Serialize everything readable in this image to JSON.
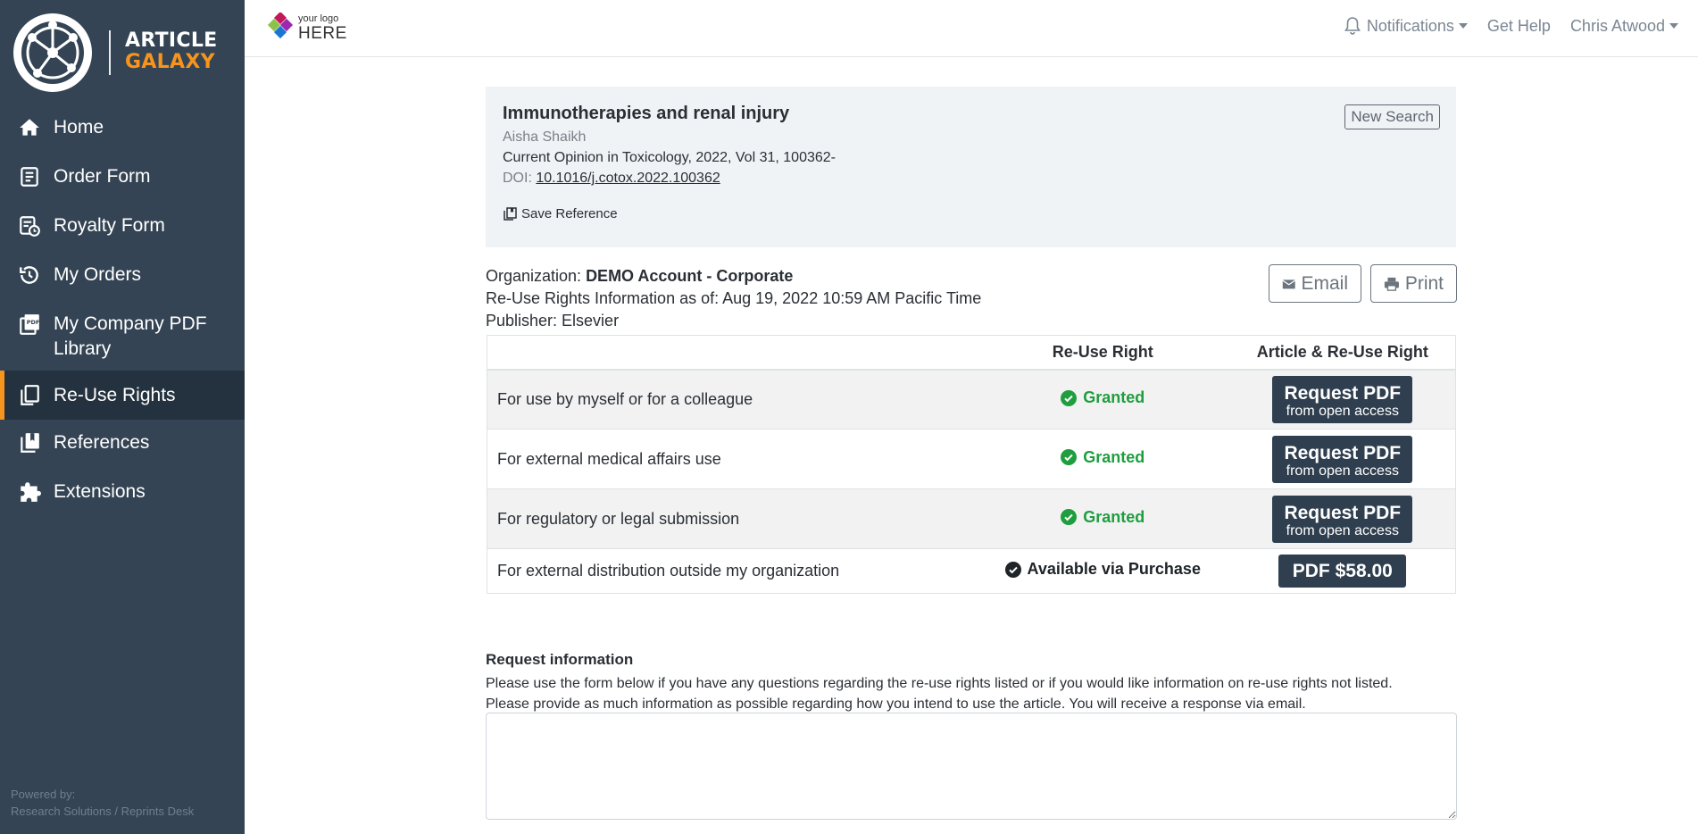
{
  "brand": {
    "line1": "ARTICLE",
    "line2": "GALAXY",
    "accent": "#f7941d"
  },
  "sidebar": {
    "items": [
      {
        "label": "Home",
        "icon": "home-icon"
      },
      {
        "label": "Order Form",
        "icon": "order-form-icon"
      },
      {
        "label": "Royalty Form",
        "icon": "royalty-form-icon"
      },
      {
        "label": "My Orders",
        "icon": "history-icon"
      },
      {
        "label": "My Company PDF Library",
        "icon": "pdf-icon"
      },
      {
        "label": "Re-Use Rights",
        "icon": "copy-icon",
        "active": true
      },
      {
        "label": "References",
        "icon": "references-icon"
      },
      {
        "label": "Extensions",
        "icon": "puzzle-icon"
      }
    ],
    "powered_by": "Powered by:",
    "powered_company": "Research Solutions / Reprints Desk"
  },
  "topbar": {
    "logo_small": "your logo",
    "logo_big": "HERE",
    "notifications": "Notifications",
    "get_help": "Get Help",
    "user": "Chris Atwood"
  },
  "article": {
    "title": "Immunotherapies and renal injury",
    "author": "Aisha Shaikh",
    "journal": "Current Opinion in Toxicology, 2022, Vol 31, 100362-",
    "doi_label": "DOI: ",
    "doi": "10.1016/j.cotox.2022.100362",
    "save_reference": "Save Reference",
    "new_search": "New Search"
  },
  "org": {
    "org_label": "Organization: ",
    "org_name": "DEMO Account - Corporate",
    "rights_info": "Re-Use Rights Information as of: Aug 19, 2022 10:59 AM Pacific Time",
    "publisher": "Publisher: Elsevier",
    "email_button": "Email",
    "print_button": "Print"
  },
  "table": {
    "headers": [
      "",
      "Re-Use Right",
      "Article & Re-Use Right"
    ],
    "rows": [
      {
        "use": "For use by myself or for a colleague",
        "status": "Granted",
        "action_line1": "Request PDF",
        "action_line2": "from open access"
      },
      {
        "use": "For external medical affairs use",
        "status": "Granted",
        "action_line1": "Request PDF",
        "action_line2": "from open access"
      },
      {
        "use": "For regulatory or legal submission",
        "status": "Granted",
        "action_line1": "Request PDF",
        "action_line2": "from open access"
      },
      {
        "use": "For external distribution outside my organization",
        "status": "Available via Purchase",
        "action_line1": "PDF $58.00"
      }
    ]
  },
  "request_info": {
    "title": "Request information",
    "line1": "Please use the form below if you have any questions regarding the re-use rights listed or if you would like information on re-use rights not listed.",
    "line2": "Please provide as much information as possible regarding how you intend to use the article. You will receive a response via email.",
    "value": ""
  }
}
